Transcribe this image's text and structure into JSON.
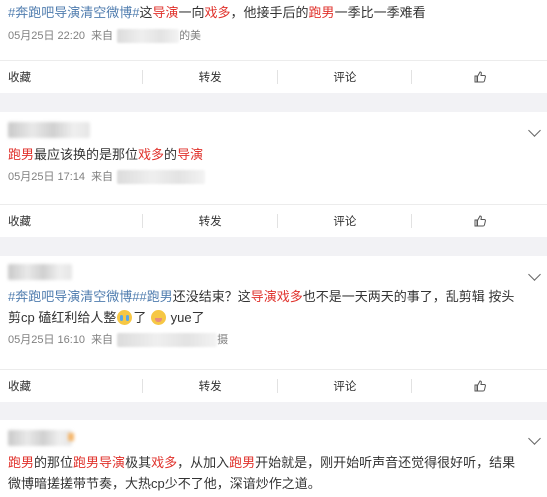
{
  "posts": [
    {
      "header_user": null,
      "segments": [
        {
          "t": "#奔跑吧导演清空微博#",
          "c": "blue"
        },
        {
          "t": "这",
          "c": ""
        },
        {
          "t": "导演",
          "c": "red"
        },
        {
          "t": "一向",
          "c": ""
        },
        {
          "t": "戏多",
          "c": "red"
        },
        {
          "t": "，他接手后的",
          "c": ""
        },
        {
          "t": "跑男",
          "c": "red"
        },
        {
          "t": "一季比一季难看",
          "c": ""
        }
      ],
      "date": "05月25日 22:20",
      "source_label": "来自",
      "source_suffix": "的美"
    },
    {
      "segments": [
        {
          "t": "跑男",
          "c": "red"
        },
        {
          "t": "最应该换的是那位",
          "c": ""
        },
        {
          "t": "戏多",
          "c": "red"
        },
        {
          "t": "的",
          "c": ""
        },
        {
          "t": "导演",
          "c": "red"
        }
      ],
      "date": "05月25日 17:14",
      "source_label": "来自",
      "source_suffix": ""
    },
    {
      "segments": [
        {
          "t": "#奔跑吧导演清空微博#",
          "c": "blue"
        },
        {
          "t": "#跑男",
          "c": "blue"
        },
        {
          "t": "还没结束？这",
          "c": ""
        },
        {
          "t": "导演",
          "c": "red"
        },
        {
          "t": "戏多",
          "c": "red"
        },
        {
          "t": "也不是一天两天的事了，乱剪辑 按头剪cp 磕红利给人整",
          "c": ""
        }
      ],
      "line_tail_1": "了",
      "line_tail_2": "yue了",
      "date": "05月25日 16:10",
      "source_label": "来自",
      "source_suffix": "摄"
    },
    {
      "segments": [
        {
          "t": "跑男",
          "c": "red"
        },
        {
          "t": "的那位",
          "c": ""
        },
        {
          "t": "跑男",
          "c": "red"
        },
        {
          "t": "导演",
          "c": "red"
        },
        {
          "t": "极其",
          "c": ""
        },
        {
          "t": "戏多",
          "c": "red"
        },
        {
          "t": "，从加入",
          "c": ""
        },
        {
          "t": "跑男",
          "c": "red"
        },
        {
          "t": "开始就是，刚开始听声音还觉得很好听，结果微博暗搓搓带节奏，大热cp少不了他，深谙炒作之道。",
          "c": ""
        }
      ]
    }
  ],
  "actions": {
    "collect": "收藏",
    "repost": "转发",
    "comment": "评论"
  },
  "colors": {
    "topic": "#507daf",
    "keyword": "#e0322c",
    "meta": "#808080"
  },
  "icons": {
    "like": "thumbs-up-icon",
    "expand": "chevron-down-icon"
  }
}
